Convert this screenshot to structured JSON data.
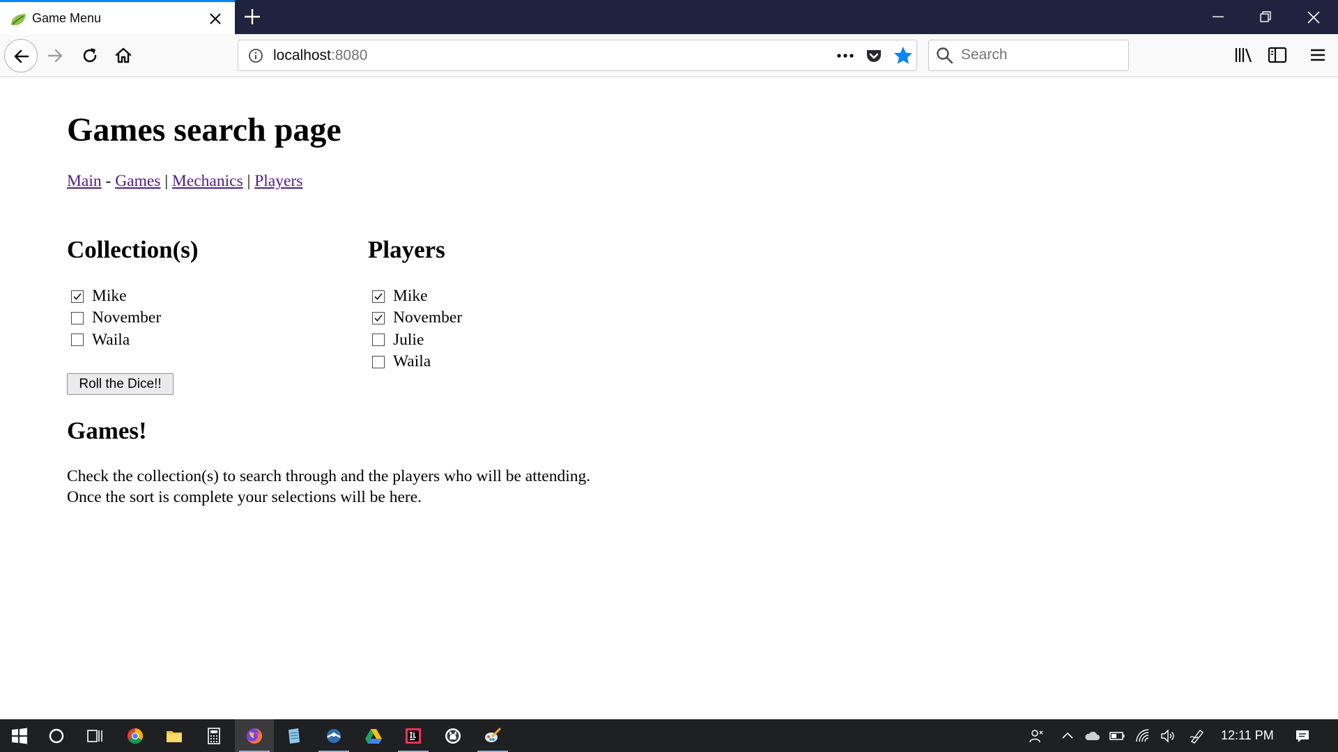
{
  "browser": {
    "tab_title": "Game Menu",
    "url_host": "localhost",
    "url_port": ":8080",
    "search_placeholder": "Search",
    "accent_color": "#0a84ff"
  },
  "page": {
    "title": "Games search page",
    "nav": [
      {
        "label": "Main"
      },
      {
        "sep": " - "
      },
      {
        "label": "Games"
      },
      {
        "sep": " | "
      },
      {
        "label": "Mechanics"
      },
      {
        "sep": " | "
      },
      {
        "label": "Players"
      }
    ],
    "collections": {
      "heading": "Collection(s)",
      "items": [
        {
          "label": "Mike",
          "checked": true
        },
        {
          "label": "November",
          "checked": false
        },
        {
          "label": "Waila",
          "checked": false
        }
      ]
    },
    "players": {
      "heading": "Players",
      "items": [
        {
          "label": "Mike",
          "checked": true
        },
        {
          "label": "November",
          "checked": true
        },
        {
          "label": "Julie",
          "checked": false
        },
        {
          "label": "Waila",
          "checked": false
        }
      ]
    },
    "roll_button": "Roll the Dice!!",
    "games_heading": "Games!",
    "games_desc_line1": "Check the collection(s) to search through and the players who will be attending.",
    "games_desc_line2": "Once the sort is complete your selections will be here.",
    "link_color": "#551a8b"
  },
  "taskbar": {
    "clock": "12:11 PM",
    "apps": [
      "windows-start-icon",
      "cortana-icon",
      "task-view-icon",
      "chrome-icon",
      "file-explorer-icon",
      "calculator-icon",
      "firefox-icon",
      "notepad-icon",
      "app-icon",
      "google-drive-icon",
      "intellij-icon",
      "github-icon",
      "paint-icon"
    ]
  }
}
